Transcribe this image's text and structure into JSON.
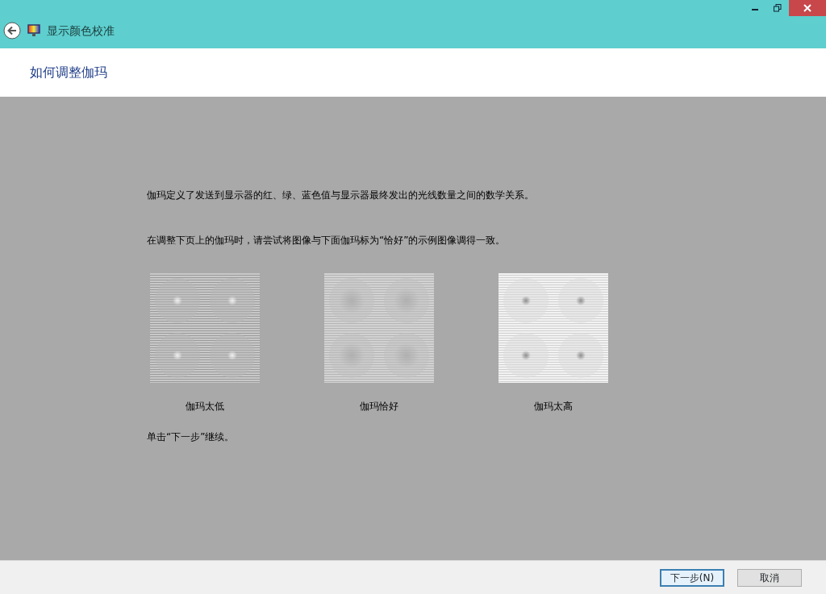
{
  "window": {
    "title": "显示颜色校准"
  },
  "header": {
    "title": "如何调整伽玛"
  },
  "paragraphs": [
    "伽玛定义了发送到显示器的红、绿、蓝色值与显示器最终发出的光线数量之间的数学关系。",
    "在调整下页上的伽玛时，请尝试将图像与下面伽玛标为“恰好”的示例图像调得一致。"
  ],
  "samples": [
    {
      "kind": "low",
      "label": "伽玛太低"
    },
    {
      "kind": "ok",
      "label": "伽玛恰好"
    },
    {
      "kind": "high",
      "label": "伽玛太高"
    }
  ],
  "note": "单击“下一步”继续。",
  "buttons": [
    {
      "label": "下一步(N)",
      "default": true
    },
    {
      "label": "取消",
      "default": false
    }
  ]
}
